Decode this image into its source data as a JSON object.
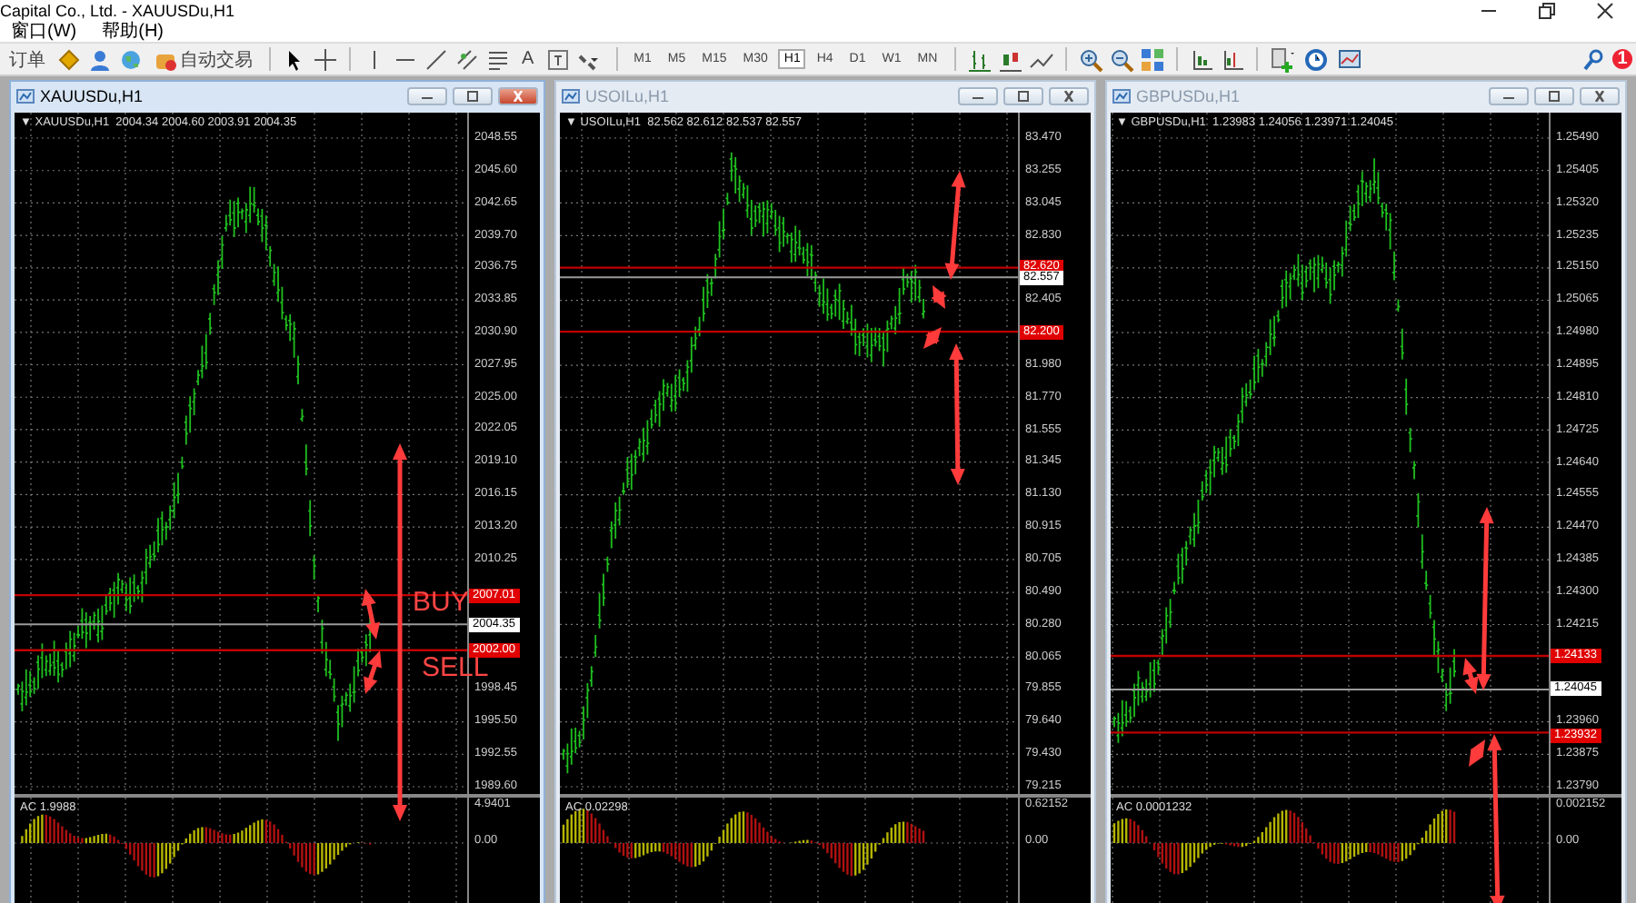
{
  "window": {
    "title": "Capital Co., Ltd. - XAUUSDu,H1"
  },
  "menu": [
    {
      "label": "窗口(W)"
    },
    {
      "label": "帮助(H)"
    }
  ],
  "toolbar": {
    "order_label": "订单",
    "auto_trading": "自动交易",
    "text_tool": "A",
    "timeframes": [
      {
        "label": "M1",
        "selected": false
      },
      {
        "label": "M5",
        "selected": false
      },
      {
        "label": "M15",
        "selected": false
      },
      {
        "label": "M30",
        "selected": false
      },
      {
        "label": "H1",
        "selected": true
      },
      {
        "label": "H4",
        "selected": false
      },
      {
        "label": "D1",
        "selected": false
      },
      {
        "label": "W1",
        "selected": false
      },
      {
        "label": "MN",
        "selected": false
      }
    ],
    "notifications": "1"
  },
  "charts": [
    {
      "title": "XAUUSDu,H1",
      "active": true,
      "marker": "▼",
      "symbol": "XAUUSDu,H1",
      "quote": "2004.34 2004.60 2003.91 2004.35",
      "price_ticks": [
        "2048.55",
        "2045.60",
        "2042.65",
        "2039.70",
        "2036.75",
        "2033.85",
        "2030.90",
        "2027.95",
        "2025.00",
        "2022.05",
        "2019.10",
        "2016.15",
        "2013.20",
        "2010.25",
        "1998.45",
        "1995.50",
        "1992.55",
        "1989.60"
      ],
      "current_price": "2004.35",
      "levels": [
        {
          "price": "2007.01"
        },
        {
          "price": "2002.00"
        }
      ],
      "annotations": [
        {
          "text": "BUY"
        },
        {
          "text": "SELL"
        }
      ],
      "indicator": {
        "label": "AC 1.9988",
        "max": "4.9401",
        "zero": "0.00"
      }
    },
    {
      "title": "USOILu,H1",
      "active": false,
      "marker": "▼",
      "symbol": "USOILu,H1",
      "quote": "82.562 82.612 82.537 82.557",
      "price_ticks": [
        "83.470",
        "83.255",
        "83.045",
        "82.830",
        "82.405",
        "81.980",
        "81.770",
        "81.555",
        "81.345",
        "81.130",
        "80.915",
        "80.705",
        "80.490",
        "80.280",
        "80.065",
        "79.855",
        "79.640",
        "79.430",
        "79.215"
      ],
      "current_price": "82.557",
      "levels": [
        {
          "price": "82.620"
        },
        {
          "price": "82.200"
        }
      ],
      "indicator": {
        "label": "AC 0.02298",
        "max": "0.62152",
        "zero": "0.00"
      }
    },
    {
      "title": "GBPUSDu,H1",
      "active": false,
      "marker": "▼",
      "symbol": "GBPUSDu,H1",
      "quote": "1.23983 1.24056 1.23971 1.24045",
      "price_ticks": [
        "1.25490",
        "1.25405",
        "1.25320",
        "1.25235",
        "1.25150",
        "1.25065",
        "1.24980",
        "1.24895",
        "1.24810",
        "1.24725",
        "1.24640",
        "1.24555",
        "1.24470",
        "1.24385",
        "1.24300",
        "1.24215",
        "1.23960",
        "1.23875",
        "1.23790"
      ],
      "current_price": "1.24045",
      "levels": [
        {
          "price": "1.24133"
        },
        {
          "price": "1.23932"
        }
      ],
      "indicator": {
        "label": "AC 0.0001232",
        "max": "0.002152",
        "zero": "0.00"
      }
    }
  ]
}
